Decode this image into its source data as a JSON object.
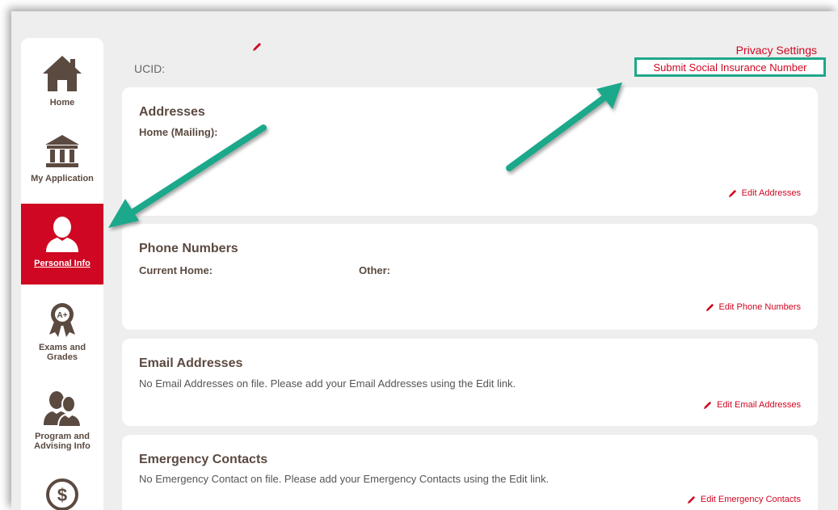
{
  "sidebar": {
    "items": [
      {
        "label": "Home",
        "icon": "home-icon"
      },
      {
        "label": "My Application",
        "icon": "bank-building-icon"
      },
      {
        "label": "Personal Info",
        "icon": "person-icon",
        "active": true
      },
      {
        "label": "Exams and Grades",
        "icon": "award-ribbon-icon"
      },
      {
        "label": "Program and Advising Info",
        "icon": "people-icon"
      },
      {
        "label": "",
        "icon": "dollar-coin-icon"
      }
    ]
  },
  "header": {
    "ucid_label": "UCID:",
    "privacy_settings": "Privacy Settings",
    "submit_sin": "Submit Social Insurance Number"
  },
  "addresses": {
    "title": "Addresses",
    "home_mailing_label": "Home (Mailing):",
    "edit_label": "Edit Addresses"
  },
  "phone": {
    "title": "Phone Numbers",
    "current_home_label": "Current Home:",
    "other_label": "Other:",
    "edit_label": "Edit Phone Numbers"
  },
  "email": {
    "title": "Email Addresses",
    "empty_text": "No Email Addresses on file. Please add your Email Addresses using the Edit link.",
    "edit_label": "Edit Email Addresses"
  },
  "emergency": {
    "title": "Emergency Contacts",
    "empty_text": "No Emergency Contact on file. Please add your Emergency Contacts using the Edit link.",
    "edit_label": "Edit Emergency Contacts"
  },
  "colors": {
    "accent": "#cf0722",
    "brown": "#5b4a40",
    "annotation": "#1fa88a"
  }
}
